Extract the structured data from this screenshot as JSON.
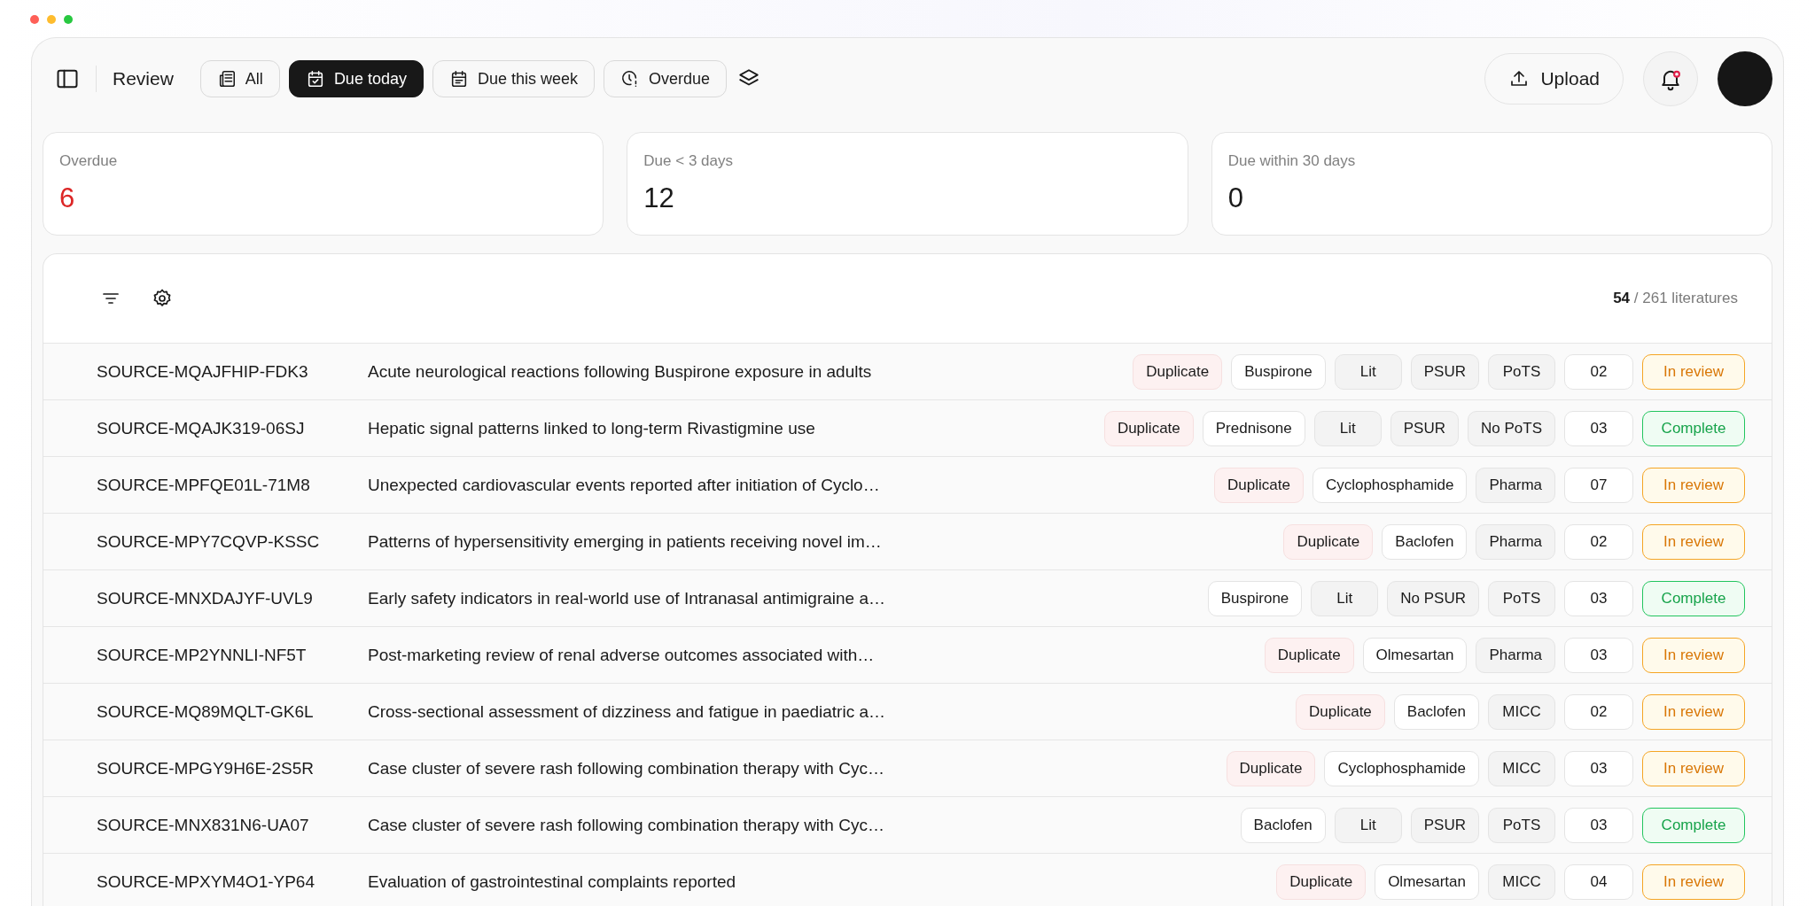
{
  "header": {
    "title": "Review",
    "filters": [
      {
        "label": "All",
        "selected": false
      },
      {
        "label": "Due today",
        "selected": true
      },
      {
        "label": "Due this week",
        "selected": false
      },
      {
        "label": "Overdue",
        "selected": false
      }
    ],
    "upload": "Upload",
    "notifications_unread": true
  },
  "stats": [
    {
      "label": "Overdue",
      "value": "6",
      "alert": true
    },
    {
      "label": "Due < 3 days",
      "value": "12",
      "alert": false
    },
    {
      "label": "Due within 30 days",
      "value": "0",
      "alert": false
    }
  ],
  "table": {
    "count": "54",
    "count_total": "/ 261 literatures",
    "rows": [
      {
        "id": "SOURCE-MQAJFHIP-FDK3",
        "title": "Acute neurological reactions following Buspirone exposure in adults",
        "tags": [
          {
            "label": "Duplicate",
            "kind": "duplicate"
          },
          {
            "label": "Buspirone",
            "kind": "drug"
          },
          {
            "label": "Lit",
            "kind": "tag"
          },
          {
            "label": "PSUR",
            "kind": "tag"
          },
          {
            "label": "PoTS",
            "kind": "tag"
          },
          {
            "label": "02",
            "kind": "count"
          },
          {
            "label": "In review",
            "kind": "in_review"
          }
        ]
      },
      {
        "id": "SOURCE-MQAJK319-06SJ",
        "title": "Hepatic signal patterns linked to long-term Rivastigmine use",
        "tags": [
          {
            "label": "Duplicate",
            "kind": "duplicate"
          },
          {
            "label": "Prednisone",
            "kind": "drug"
          },
          {
            "label": "Lit",
            "kind": "tag"
          },
          {
            "label": "PSUR",
            "kind": "tag"
          },
          {
            "label": "No PoTS",
            "kind": "tag"
          },
          {
            "label": "03",
            "kind": "count"
          },
          {
            "label": "Complete",
            "kind": "complete"
          }
        ]
      },
      {
        "id": "SOURCE-MPFQE01L-71M8",
        "title": "Unexpected cardiovascular events reported after initiation of Cyclo…",
        "tags": [
          {
            "label": "Duplicate",
            "kind": "duplicate"
          },
          {
            "label": "Cyclophosphamide",
            "kind": "drug"
          },
          {
            "label": "Pharma",
            "kind": "tag"
          },
          {
            "label": "07",
            "kind": "count"
          },
          {
            "label": "In review",
            "kind": "in_review"
          }
        ]
      },
      {
        "id": "SOURCE-MPY7CQVP-KSSC",
        "title": "Patterns of hypersensitivity emerging in patients receiving novel im…",
        "tags": [
          {
            "label": "Duplicate",
            "kind": "duplicate"
          },
          {
            "label": "Baclofen",
            "kind": "drug"
          },
          {
            "label": "Pharma",
            "kind": "tag"
          },
          {
            "label": "02",
            "kind": "count"
          },
          {
            "label": "In review",
            "kind": "in_review"
          }
        ]
      },
      {
        "id": "SOURCE-MNXDAJYF-UVL9",
        "title": "Early safety indicators in real-world use of Intranasal antimigraine a…",
        "tags": [
          {
            "label": "Buspirone",
            "kind": "drug"
          },
          {
            "label": "Lit",
            "kind": "tag"
          },
          {
            "label": "No PSUR",
            "kind": "tag"
          },
          {
            "label": "PoTS",
            "kind": "tag"
          },
          {
            "label": "03",
            "kind": "count"
          },
          {
            "label": "Complete",
            "kind": "complete"
          }
        ]
      },
      {
        "id": "SOURCE-MP2YNNLI-NF5T",
        "title": "Post-marketing review of renal adverse outcomes associated with…",
        "tags": [
          {
            "label": "Duplicate",
            "kind": "duplicate"
          },
          {
            "label": "Olmesartan",
            "kind": "drug"
          },
          {
            "label": "Pharma",
            "kind": "tag"
          },
          {
            "label": "03",
            "kind": "count"
          },
          {
            "label": "In review",
            "kind": "in_review"
          }
        ]
      },
      {
        "id": "SOURCE-MQ89MQLT-GK6L",
        "title": "Cross-sectional assessment of dizziness and fatigue in paediatric a…",
        "tags": [
          {
            "label": "Duplicate",
            "kind": "duplicate"
          },
          {
            "label": "Baclofen",
            "kind": "drug"
          },
          {
            "label": "MICC",
            "kind": "tag"
          },
          {
            "label": "02",
            "kind": "count"
          },
          {
            "label": "In review",
            "kind": "in_review"
          }
        ]
      },
      {
        "id": "SOURCE-MPGY9H6E-2S5R",
        "title": "Case cluster of severe rash following combination therapy with Cyc…",
        "tags": [
          {
            "label": "Duplicate",
            "kind": "duplicate"
          },
          {
            "label": "Cyclophosphamide",
            "kind": "drug"
          },
          {
            "label": "MICC",
            "kind": "tag"
          },
          {
            "label": "03",
            "kind": "count"
          },
          {
            "label": "In review",
            "kind": "in_review"
          }
        ]
      },
      {
        "id": "SOURCE-MNX831N6-UA07",
        "title": "Case cluster of severe rash following combination therapy with Cyc…",
        "tags": [
          {
            "label": "Baclofen",
            "kind": "drug"
          },
          {
            "label": "Lit",
            "kind": "tag"
          },
          {
            "label": "PSUR",
            "kind": "tag"
          },
          {
            "label": "PoTS",
            "kind": "tag"
          },
          {
            "label": "03",
            "kind": "count"
          },
          {
            "label": "Complete",
            "kind": "complete"
          }
        ]
      },
      {
        "id": "SOURCE-MPXYM4O1-YP64",
        "title": "Evaluation of gastrointestinal complaints reported",
        "tags": [
          {
            "label": "Duplicate",
            "kind": "duplicate"
          },
          {
            "label": "Olmesartan",
            "kind": "drug"
          },
          {
            "label": "MICC",
            "kind": "tag"
          },
          {
            "label": "04",
            "kind": "count"
          },
          {
            "label": "In review",
            "kind": "in_review"
          }
        ]
      }
    ]
  }
}
